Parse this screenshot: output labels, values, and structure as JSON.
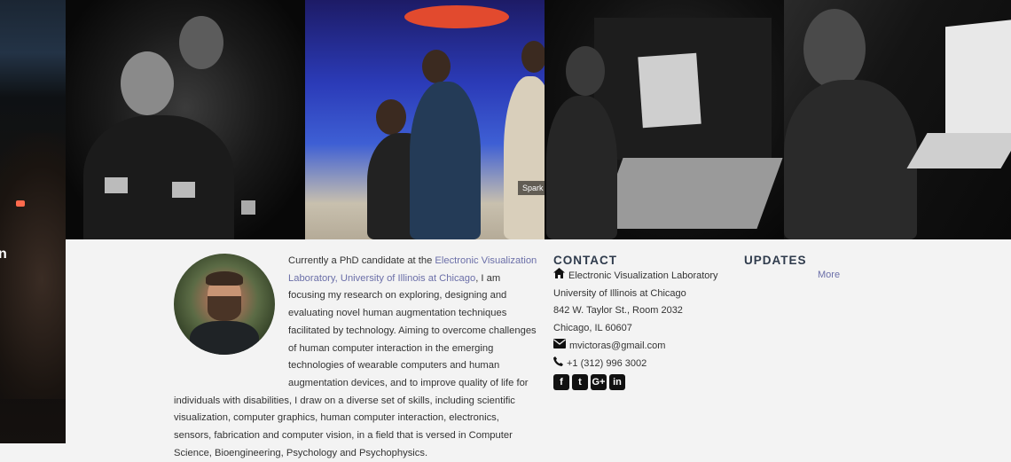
{
  "left_strip": {
    "fragment_text": "n"
  },
  "banner": {
    "photos": [
      {
        "icon": "photo-motion-capture"
      },
      {
        "icon": "photo-visualization-wall",
        "caption": "Spark"
      },
      {
        "icon": "photo-tabletop-display"
      },
      {
        "icon": "photo-desk-research"
      }
    ]
  },
  "bio": {
    "intro": "Currently a PhD candidate at the ",
    "lab_link": "Electronic Visualization Laboratory, University of Illinois at Chicago",
    "rest": ", I am focusing my research on exploring, designing and evaluating novel human augmentation techniques facilitated by technology. Aiming to overcome challenges of human computer interaction in the emerging technologies of wearable computers and human augmentation devices, and to improve quality of life for individuals with disabilities, I draw on a diverse set of skills, including scientific visualization, computer graphics, human computer interaction, electronics, sensors, fabrication and computer vision, in a field that is versed in Computer Science, Bioengineering, Psychology and Psychophysics."
  },
  "contact": {
    "heading": "CONTACT",
    "org": "Electronic Visualization Laboratory",
    "university": "University of Illinois at Chicago",
    "street": "842 W. Taylor St., Room 2032",
    "city": "Chicago, IL 60607",
    "email": "mvictoras@gmail.com",
    "phone": "+1 (312) 996 3002",
    "social": [
      {
        "icon": "facebook-icon",
        "glyph": "f"
      },
      {
        "icon": "twitter-icon",
        "glyph": "t"
      },
      {
        "icon": "google-plus-icon",
        "glyph": "G+"
      },
      {
        "icon": "linkedin-icon",
        "glyph": "in"
      }
    ]
  },
  "updates": {
    "heading": "UPDATES",
    "more_link": "More"
  },
  "colors": {
    "link": "#6b6fa8",
    "heading": "#2f3b4c",
    "background": "#f3f3f3"
  }
}
